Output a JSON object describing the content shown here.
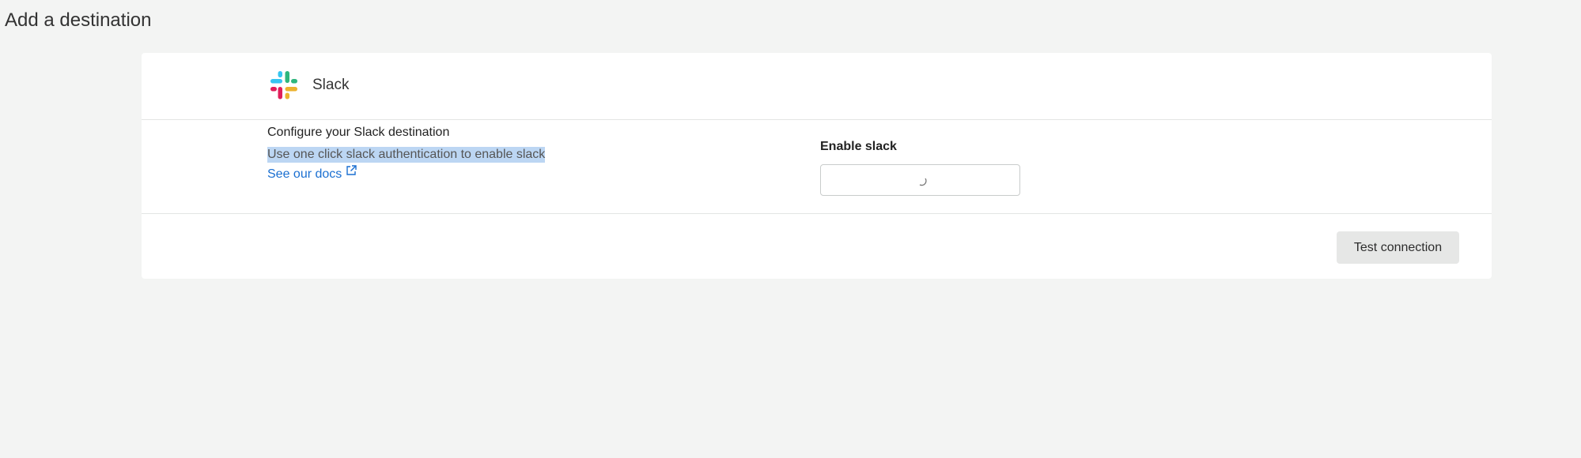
{
  "page": {
    "title": "Add a destination"
  },
  "destination": {
    "name": "Slack",
    "logo_icon": "slack-logo-icon",
    "logo_colors": [
      "#36c5f0",
      "#2eb67d",
      "#ecb22e",
      "#e01e5a"
    ]
  },
  "config": {
    "title": "Configure your Slack destination",
    "description": "Use one click slack authentication to enable slack",
    "docs_link": "See our docs",
    "docs_icon": "external-link-icon"
  },
  "enable": {
    "label": "Enable slack",
    "state": "loading",
    "spinner_icon": "loading-spinner-icon"
  },
  "footer": {
    "test_button": "Test connection"
  },
  "colors": {
    "background": "#f3f4f3",
    "card": "#ffffff",
    "link": "#1a6fd1",
    "selection_highlight": "#bcd6f3",
    "button_bg": "#e6e7e6"
  }
}
